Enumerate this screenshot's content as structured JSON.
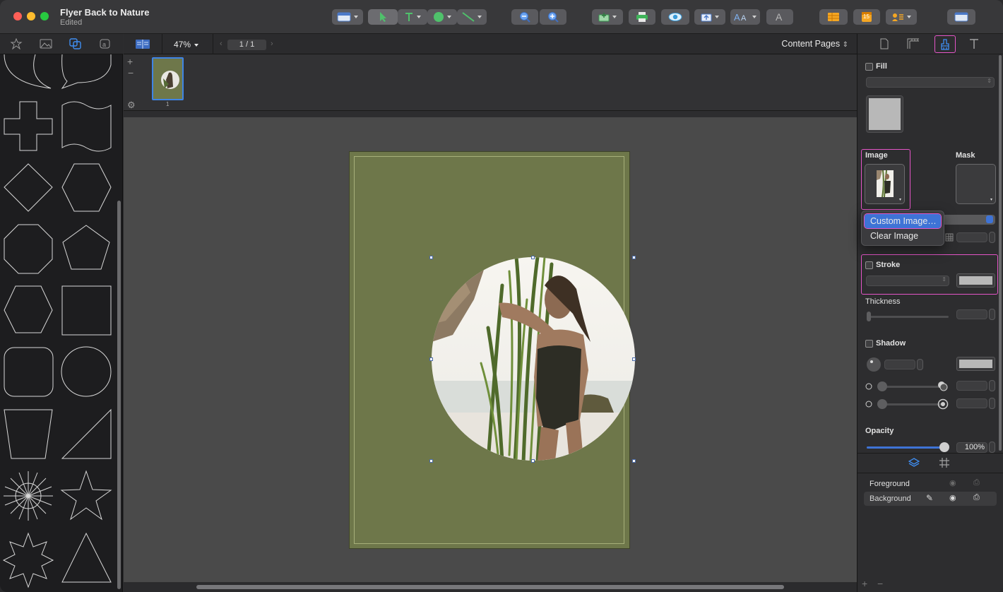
{
  "window": {
    "title": "Flyer Back to Nature",
    "subtitle": "Edited"
  },
  "toolbar": {
    "items": [
      {
        "name": "layout-view-button",
        "icon": "layout-icon"
      },
      {
        "name": "select-tool",
        "icon": "arrow-pointer-icon"
      },
      {
        "name": "text-tool",
        "icon": "text-t-icon"
      },
      {
        "name": "shape-tool",
        "icon": "circle-icon"
      },
      {
        "name": "line-tool",
        "icon": "line-icon"
      },
      {
        "name": "zoom-out-button",
        "icon": "zoom-out-icon"
      },
      {
        "name": "zoom-in-button",
        "icon": "zoom-in-icon"
      },
      {
        "name": "insert-button",
        "icon": "insert-icon"
      },
      {
        "name": "print-button",
        "icon": "printer-icon"
      },
      {
        "name": "preview-button",
        "icon": "eye-icon"
      },
      {
        "name": "export-button",
        "icon": "export-icon"
      },
      {
        "name": "fonts-button",
        "icon": "font-aa-icon"
      },
      {
        "name": "text-style-button",
        "icon": "font-a-icon"
      },
      {
        "name": "table-button",
        "icon": "table-icon"
      },
      {
        "name": "calendar-button",
        "icon": "calendar-icon"
      },
      {
        "name": "contacts-button",
        "icon": "contact-card-icon"
      },
      {
        "name": "sidebar-toggle-button",
        "icon": "sidebar-icon"
      }
    ],
    "calendar_day": "15"
  },
  "canvas_bar": {
    "zoom": "47%",
    "page_indicator": "1 / 1",
    "content_pages": "Content Pages"
  },
  "thumbnail": {
    "page_number": "1"
  },
  "right_panel": {
    "fill_label": "Fill",
    "image_label": "Image",
    "mask_label": "Mask",
    "stroke_label": "Stroke",
    "thickness_label": "Thickness",
    "shadow_label": "Shadow",
    "opacity_label": "Opacity",
    "opacity_value": "100%",
    "opacity_fraction": 1.0
  },
  "image_menu": {
    "items": [
      "Custom Image…",
      "Clear Image"
    ],
    "highlighted": 0
  },
  "layers": {
    "items": [
      {
        "label": "Foreground",
        "selected": false
      },
      {
        "label": "Background",
        "selected": true
      }
    ]
  },
  "colors": {
    "page_green": "#6e774a",
    "accent_blue": "#3e73d6",
    "highlight_pink": "#e455c7"
  }
}
